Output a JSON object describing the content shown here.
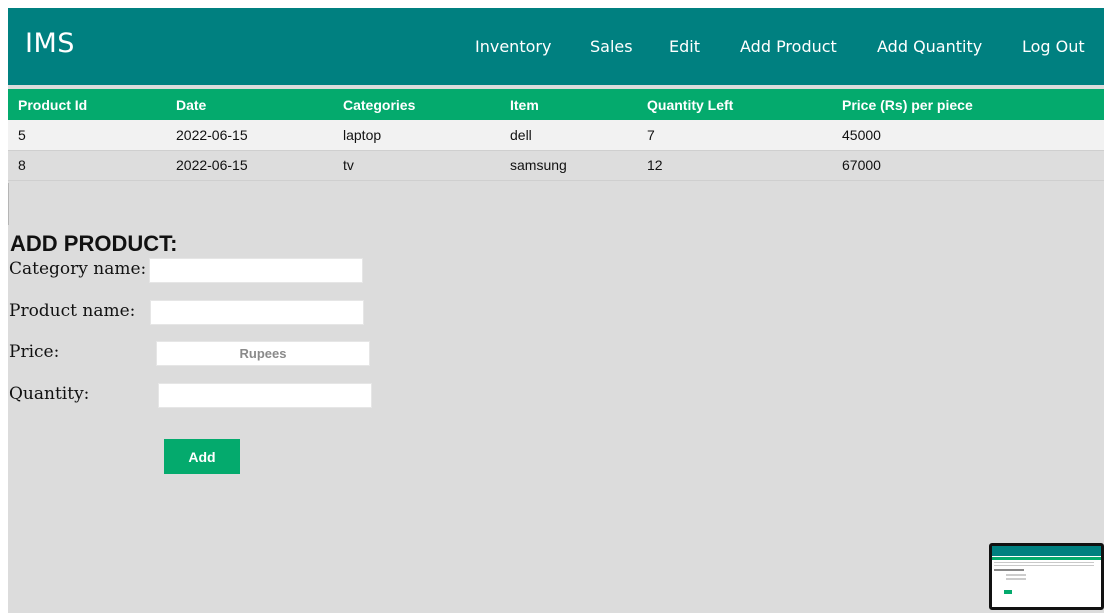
{
  "app": {
    "brand": "IMS"
  },
  "nav": {
    "inventory": "Inventory",
    "sales": "Sales",
    "edit": "Edit",
    "add_product": "Add Product",
    "add_quantity": "Add Quantity",
    "logout": "Log Out"
  },
  "table": {
    "headers": [
      "Product Id",
      "Date",
      "Categories",
      "Item",
      "Quantity Left",
      "Price (Rs) per piece"
    ],
    "rows": [
      [
        "5",
        "2022-06-15",
        "laptop",
        "dell",
        "7",
        "45000"
      ],
      [
        "8",
        "2022-06-15",
        "tv",
        "samsung",
        "12",
        "67000"
      ]
    ]
  },
  "form": {
    "heading": "ADD PRODUCT:",
    "category_label": "Category name:",
    "category_value": "",
    "product_label": "Product name:",
    "product_value": "",
    "price_label": "Price:",
    "price_placeholder": "Rupees",
    "quantity_label": "Quantity:",
    "quantity_value": "",
    "submit_label": "Add"
  },
  "colors": {
    "navbar": "#008080",
    "table_header": "#04aa6d",
    "button": "#04aa6d",
    "page_background": "#dcdcdc"
  }
}
